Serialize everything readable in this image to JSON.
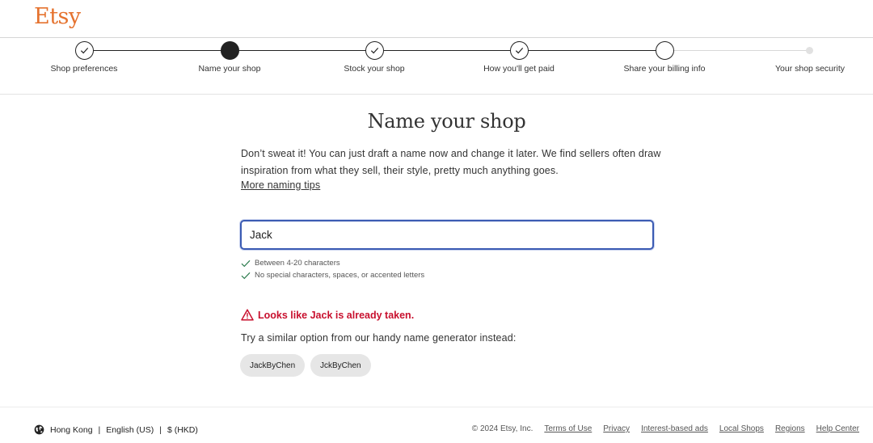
{
  "header": {
    "logo": "Etsy"
  },
  "steps": [
    {
      "label": "Shop preferences",
      "state": "done"
    },
    {
      "label": "Name your shop",
      "state": "current"
    },
    {
      "label": "Stock your shop",
      "state": "done"
    },
    {
      "label": "How you'll get paid",
      "state": "done"
    },
    {
      "label": "Share your billing info",
      "state": "pending"
    },
    {
      "label": "Your shop security",
      "state": "inactive"
    }
  ],
  "main": {
    "title": "Name your shop",
    "description": "Don’t sweat it! You can just draft a name now and change it later. We find sellers often draw inspiration from what they sell, their style, pretty much anything goes.",
    "tips_link": "More naming tips",
    "input_value": "Jack",
    "rules": [
      "Between 4-20 characters",
      "No special characters, spaces, or accented letters"
    ],
    "error": "Looks like Jack is already taken.",
    "suggest_text": "Try a similar option from our handy name generator instead:",
    "suggestions": [
      "JackByChen",
      "JckByChen"
    ]
  },
  "footer": {
    "region": "Hong Kong",
    "language": "English (US)",
    "currency": "$ (HKD)",
    "copyright": "© 2024 Etsy, Inc.",
    "links": [
      "Terms of Use",
      "Privacy",
      "Interest-based ads",
      "Local Shops",
      "Regions",
      "Help Center"
    ]
  },
  "colors": {
    "brand": "#e5722e",
    "error": "#c8102e",
    "check": "#2e7d4f",
    "input_focus": "#3b5bb3"
  }
}
